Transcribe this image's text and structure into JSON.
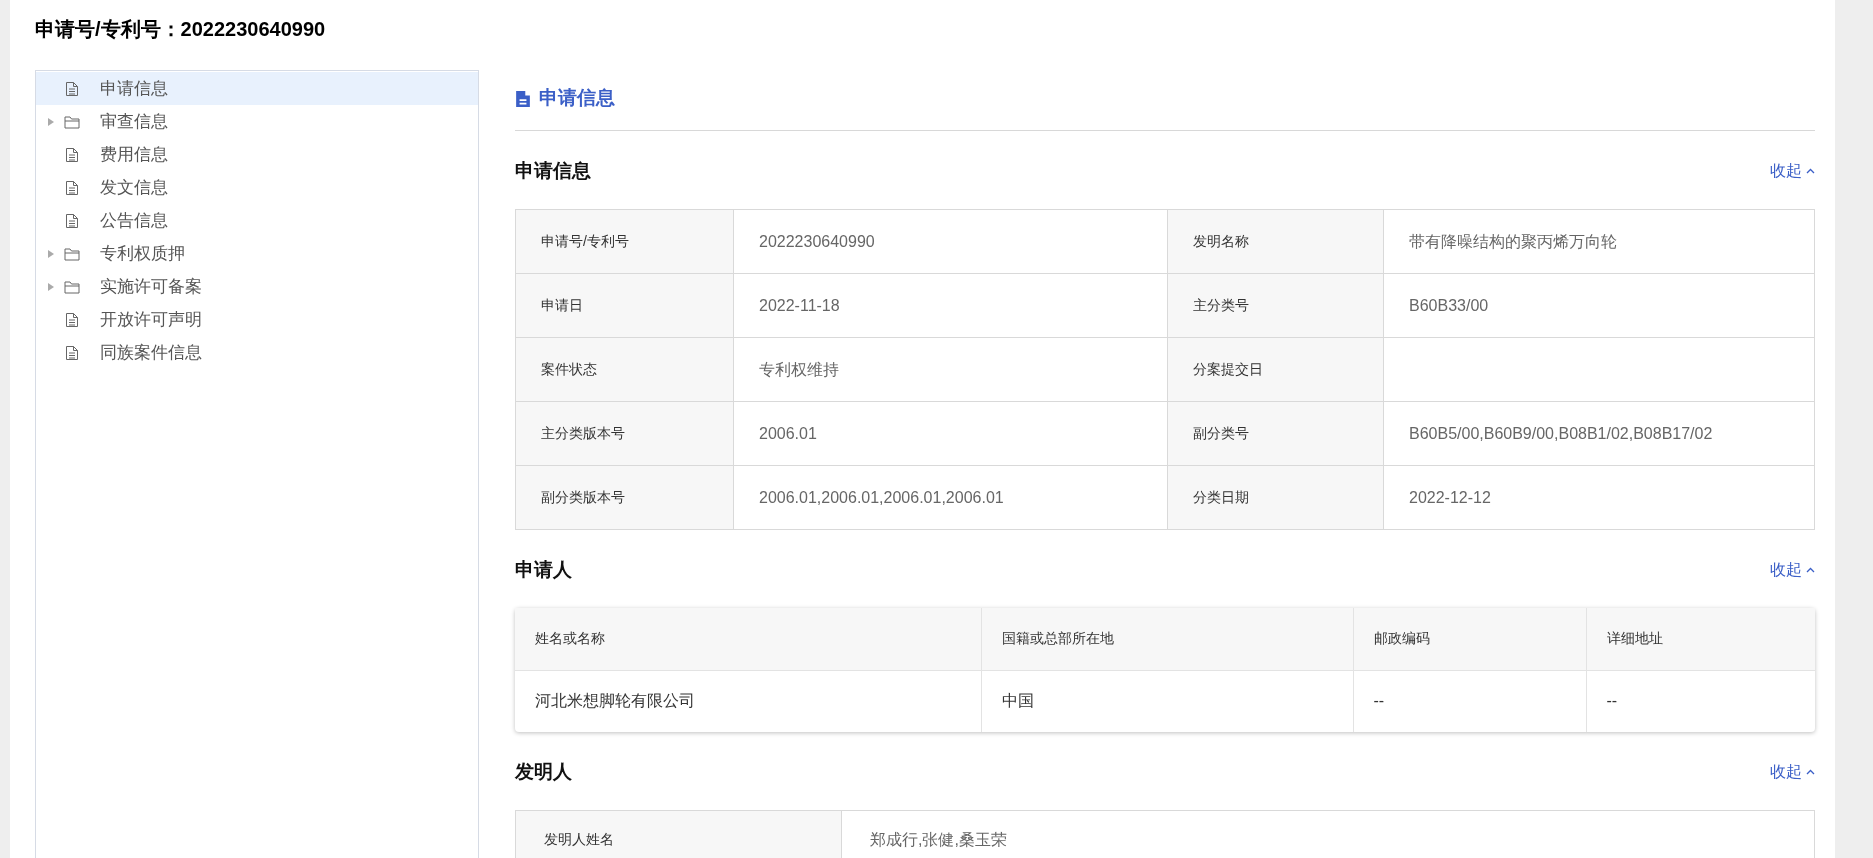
{
  "page_title": "申请号/专利号：2022230640990",
  "sidebar": {
    "items": [
      {
        "label": "申请信息",
        "kind": "file",
        "selected": true
      },
      {
        "label": "审查信息",
        "kind": "folder",
        "selected": false
      },
      {
        "label": "费用信息",
        "kind": "file",
        "selected": false
      },
      {
        "label": "发文信息",
        "kind": "file",
        "selected": false
      },
      {
        "label": "公告信息",
        "kind": "file",
        "selected": false
      },
      {
        "label": "专利权质押",
        "kind": "folder",
        "selected": false
      },
      {
        "label": "实施许可备案",
        "kind": "folder",
        "selected": false
      },
      {
        "label": "开放许可声明",
        "kind": "file",
        "selected": false
      },
      {
        "label": "同族案件信息",
        "kind": "file",
        "selected": false
      }
    ]
  },
  "main": {
    "heading": "申请信息",
    "application_info": {
      "title": "申请信息",
      "toggle": "收起",
      "rows": [
        [
          "申请号/专利号",
          "2022230640990",
          "发明名称",
          "带有降噪结构的聚丙烯万向轮"
        ],
        [
          "申请日",
          "2022-11-18",
          "主分类号",
          "B60B33/00"
        ],
        [
          "案件状态",
          "专利权维持",
          "分案提交日",
          ""
        ],
        [
          "主分类版本号",
          "2006.01",
          "副分类号",
          "B60B5/00,B60B9/00,B08B1/02,B08B17/02"
        ],
        [
          "副分类版本号",
          "2006.01,2006.01,2006.01,2006.01",
          "分类日期",
          "2022-12-12"
        ]
      ]
    },
    "applicant": {
      "title": "申请人",
      "toggle": "收起",
      "columns": [
        "姓名或名称",
        "国籍或总部所在地",
        "邮政编码",
        "详细地址"
      ],
      "rows": [
        [
          "河北米想脚轮有限公司",
          "中国",
          "--",
          "--"
        ]
      ]
    },
    "inventor": {
      "title": "发明人",
      "toggle": "收起",
      "rows": [
        [
          "发明人姓名",
          "郑成行,张健,桑玉荣"
        ]
      ]
    }
  }
}
